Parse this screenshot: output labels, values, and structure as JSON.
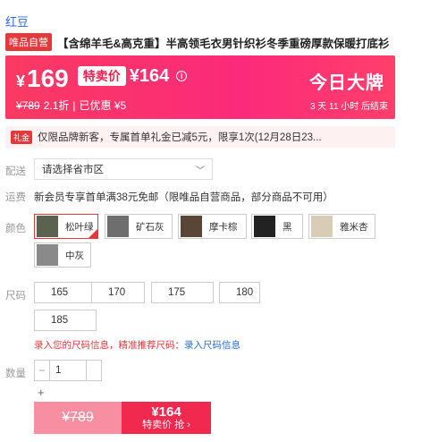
{
  "brand": "红豆",
  "product": {
    "vip_tag": "唯品自营",
    "title": "【含绵羊毛&高克重】半高领毛衣男针织衫冬季重磅厚款保暖打底衫"
  },
  "price": {
    "currency": "¥",
    "current": "169",
    "special_label": "特卖价",
    "special_price": "¥164",
    "info_icon": "i",
    "original": "¥789",
    "discount": "2.1折",
    "separator": "|",
    "saved": "已优惠 ¥5",
    "today_label": "今日大牌",
    "countdown": "3 天 11 小时 后结束"
  },
  "promo": {
    "tag": "礼金",
    "text": "仅限品牌新客，专属首单礼金已减5元，限享1次(12月28日23..."
  },
  "delivery": {
    "label": "配送",
    "select_placeholder": "请选择省市区",
    "chevron": "﹀"
  },
  "shipping": {
    "label": "运费",
    "text": "新会员专享首单满38元免邮（限唯品自营商品，部分商品不可用）"
  },
  "colors": {
    "label": "颜色",
    "options": [
      {
        "name": "松叶绿",
        "swatch": "#5b6250"
      },
      {
        "name": "矿石灰",
        "swatch": "#6e6e6e"
      },
      {
        "name": "摩卡棕",
        "swatch": "#5a4636"
      },
      {
        "name": "黑",
        "swatch": "#222222"
      },
      {
        "name": "雅米杏",
        "swatch": "#d9ccb6"
      },
      {
        "name": "中灰",
        "swatch": "#8a8a8a"
      }
    ],
    "selected": "松叶绿"
  },
  "sizes": {
    "label": "尺码",
    "options": [
      "165",
      "170",
      "175",
      "180",
      "185"
    ],
    "prompt_text": "录入您的尺码信息，精准推荐尺码：",
    "prompt_link": "录入尺码信息"
  },
  "quantity": {
    "label": "数量",
    "minus": "−",
    "value": "1",
    "plus": "+"
  },
  "buy": {
    "original_price": "¥789",
    "special_price": "¥164",
    "special_action": "特卖价 抢 ›"
  }
}
